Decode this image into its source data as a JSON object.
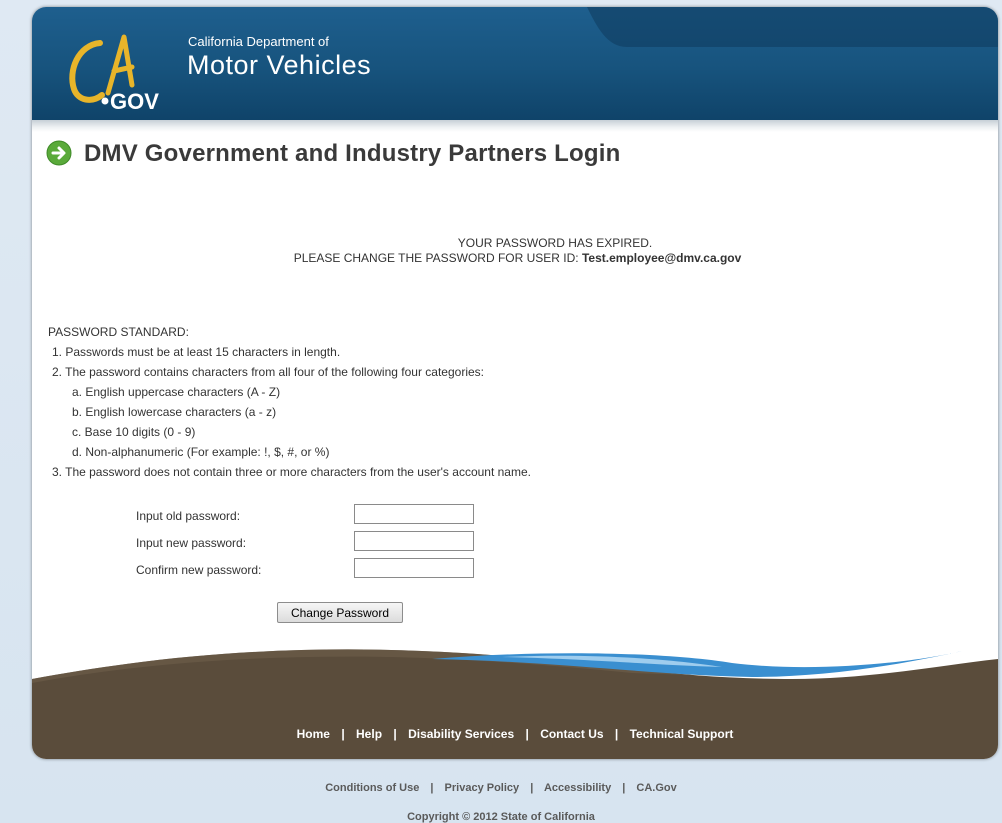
{
  "header": {
    "logo_text": "CA.GOV",
    "dept_small": "California Department of",
    "dept_big": "Motor Vehicles"
  },
  "page": {
    "title": "DMV Government and Industry Partners Login"
  },
  "message": {
    "line1": "YOUR PASSWORD HAS EXPIRED.",
    "line2_prefix": "PLEASE CHANGE THE PASSWORD FOR USER ID:",
    "user_id": "Test.employee@dmv.ca.gov"
  },
  "standard": {
    "heading": "PASSWORD STANDARD:",
    "rule1": "1. Passwords must be at least 15 characters in length.",
    "rule2": "2. The password contains characters from all four of the following four categories:",
    "cat_a": "a. English uppercase characters (A - Z)",
    "cat_b": "b. English lowercase characters (a - z)",
    "cat_c": "c. Base 10 digits (0 - 9)",
    "cat_d": "d. Non-alphanumeric (For example: !, $, #, or %)",
    "rule3": "3. The password does not contain three or more characters from the user's account name."
  },
  "form": {
    "old_label": "Input old password:",
    "old_value": "",
    "new_label": "Input new password:",
    "new_value": "",
    "confirm_label": "Confirm new password:",
    "confirm_value": "",
    "submit_label": "Change Password"
  },
  "footer": {
    "links": [
      "Home",
      "Help",
      "Disability Services",
      "Contact Us",
      "Technical Support"
    ],
    "separator": "|"
  },
  "bottom": {
    "links": [
      "Conditions of Use",
      "Privacy Policy",
      "Accessibility",
      "CA.Gov"
    ],
    "copyright": "Copyright © 2012 State of California"
  },
  "colors": {
    "header_blue": "#17537d",
    "footer_brown": "#5a4c3b",
    "wave_blue": "#3a8fd0",
    "title_gray": "#3a3a3a",
    "icon_green": "#5aaa3a"
  }
}
